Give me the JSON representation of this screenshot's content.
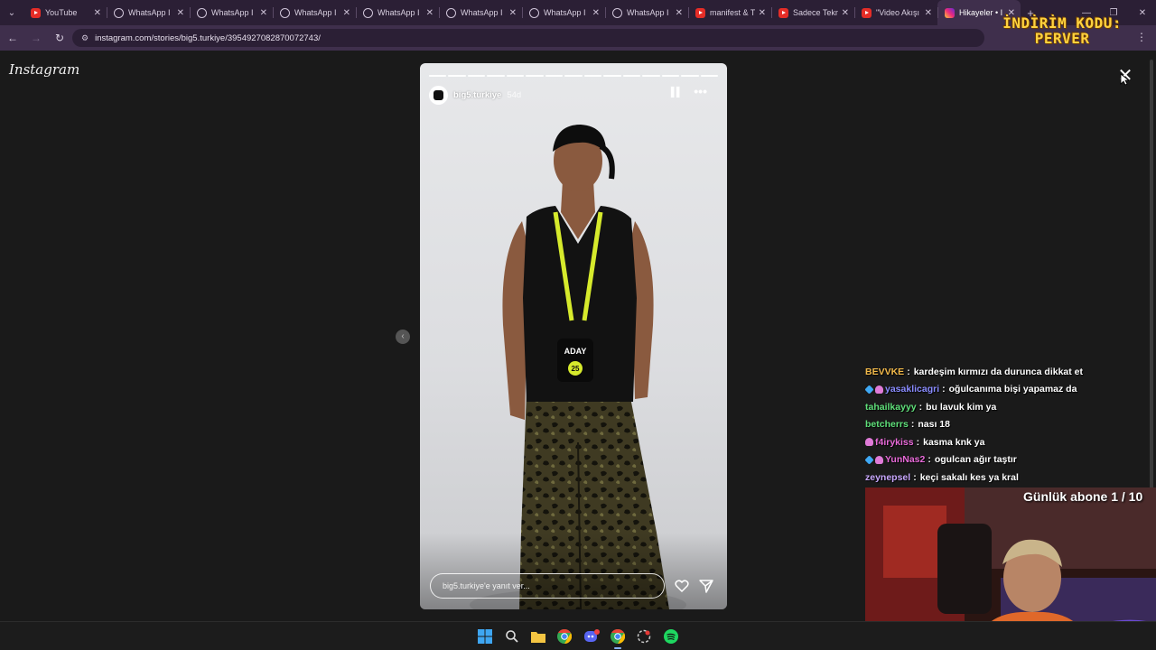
{
  "browser": {
    "tabs": [
      {
        "title": "YouTube",
        "icon": "youtube-icon",
        "active": false
      },
      {
        "title": "WhatsApp I",
        "icon": "globe-icon",
        "active": false
      },
      {
        "title": "WhatsApp I",
        "icon": "globe-icon",
        "active": false
      },
      {
        "title": "WhatsApp I",
        "icon": "globe-icon",
        "active": false
      },
      {
        "title": "WhatsApp I",
        "icon": "globe-icon",
        "active": false
      },
      {
        "title": "WhatsApp I",
        "icon": "globe-icon",
        "active": false
      },
      {
        "title": "WhatsApp I",
        "icon": "globe-icon",
        "active": false
      },
      {
        "title": "WhatsApp I",
        "icon": "globe-icon",
        "active": false
      },
      {
        "title": "manifest & T",
        "icon": "youtube-icon",
        "active": false
      },
      {
        "title": "Sadece Tekn",
        "icon": "youtube-icon",
        "active": false
      },
      {
        "title": "\"Video Akışı",
        "icon": "youtube-icon",
        "active": false
      },
      {
        "title": "Hikayeler • I",
        "icon": "instagram-icon",
        "active": true
      }
    ],
    "url": "instagram.com/stories/big5.turkiye/3954927082870072743/"
  },
  "overlay_promo": {
    "line1": "İNDİRİM KODU:",
    "line2": "PERVER"
  },
  "page": {
    "logo": "Instagram",
    "story": {
      "username": "big5.turkiye",
      "time_ago": "54d",
      "segments": 15,
      "reply_placeholder": "big5.turkiye'e yanıt ver...",
      "badge_text": "ADAY",
      "badge_number": "25"
    }
  },
  "chat": [
    {
      "user": "BEVVKE",
      "color": "#f2b94a",
      "badges": [],
      "text": "kardeşim kırmızı da durunca dikkat et"
    },
    {
      "user": "yasaklicagri",
      "color": "#8a8cff",
      "badges": [
        "gem",
        "bfly"
      ],
      "text": "oğulcanıma bişi yapamaz da"
    },
    {
      "user": "tahailkayyy",
      "color": "#5fe07a",
      "badges": [],
      "text": "bu lavuk kim ya"
    },
    {
      "user": "betcherrs",
      "color": "#5fe07a",
      "badges": [],
      "text": "nası 18"
    },
    {
      "user": "f4irykiss",
      "color": "#e86ad8",
      "badges": [
        "bfly"
      ],
      "text": "kasma knk ya"
    },
    {
      "user": "YunNas2",
      "color": "#e86ad8",
      "badges": [
        "gem",
        "bfly"
      ],
      "text": "ogulcan ağır taştır"
    },
    {
      "user": "zeynepsel",
      "color": "#c9a8ff",
      "badges": [],
      "text": "keçi sakalı kes ya kral"
    }
  ],
  "stream": {
    "sub_goal_label": "Günlük abone 1 / 10"
  }
}
